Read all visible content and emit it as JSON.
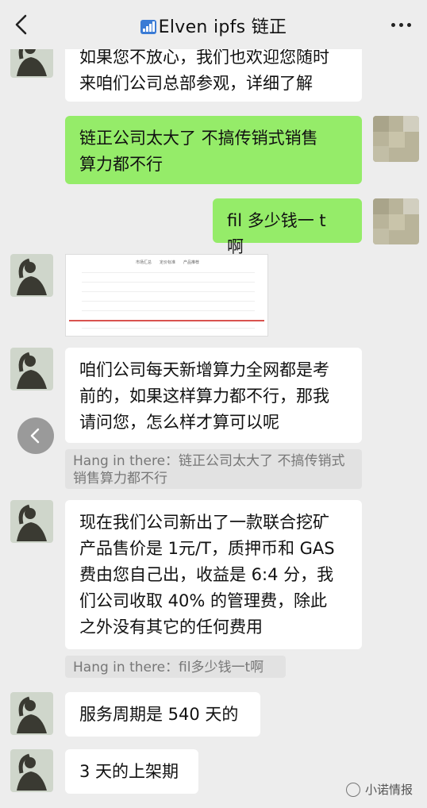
{
  "header": {
    "title": "Elven   ipfs  链正",
    "signal_icon": "signal-bars-icon",
    "back_icon": "chevron-left-icon",
    "more_icon": "ellipsis-icon"
  },
  "messages": [
    {
      "dir": "in",
      "text_lines": [
        "如果您不放心，我们也欢迎您随时",
        "来咱们公司总部参观，详细了解"
      ]
    },
    {
      "dir": "out",
      "text_lines": [
        "链正公司太大了   不搞传销式销售",
        "算力都不行"
      ]
    },
    {
      "dir": "out",
      "text_lines": [
        "fil 多少钱一 t 啊"
      ]
    },
    {
      "dir": "in",
      "type": "image",
      "tabs": [
        "市场汇总",
        "定价标准",
        "产品推荐"
      ]
    },
    {
      "dir": "in",
      "text_lines": [
        "咱们公司每天新增算力全网都是考",
        "前的，如果这样算力都不行，那我",
        "请问您，怎么样才算可以呢"
      ],
      "quote": "Hang in there：链正公司太大了   不搞传销式销售算力都不行"
    },
    {
      "dir": "in",
      "text_lines": [
        "现在我们公司新出了一款联合挖矿",
        "产品售价是 1元/T，质押币和 GAS",
        "费由您自己出，收益是 6:4 分，我",
        "们公司收取 40% 的管理费，除此",
        "之外没有其它的任何费用"
      ],
      "quote": "Hang in there：fil多少钱一t啊"
    },
    {
      "dir": "in",
      "text_lines": [
        "服务周期是 540 天的"
      ]
    },
    {
      "dir": "in",
      "text_lines": [
        "3 天的上架期"
      ]
    }
  ],
  "watermark": "小诺情报",
  "colors": {
    "bg": "#ededed",
    "out_bubble": "#95ec69",
    "in_bubble": "#ffffff",
    "quote_bg": "#e2e2e2"
  }
}
